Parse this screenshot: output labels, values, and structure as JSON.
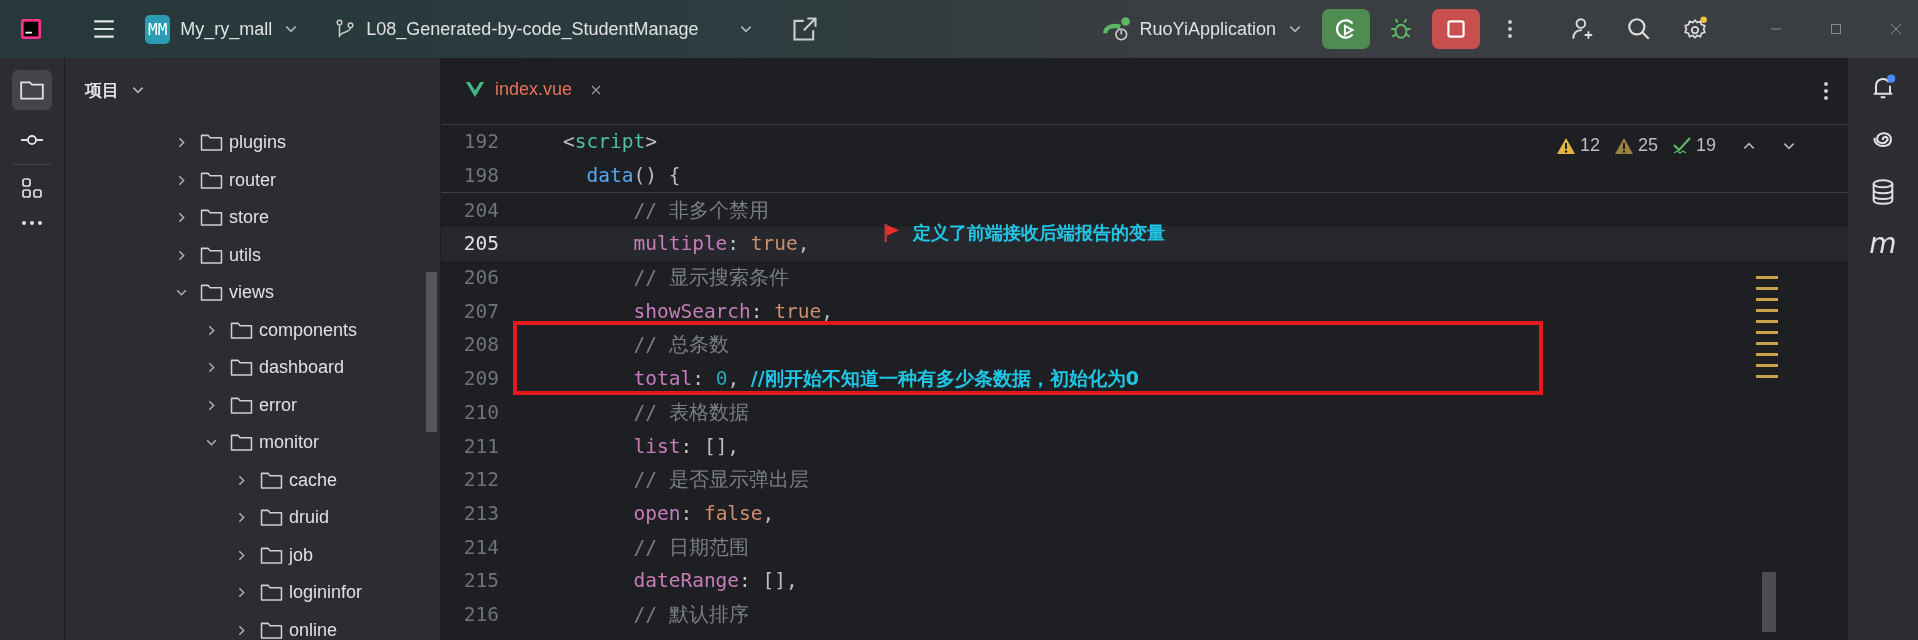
{
  "title_bar": {
    "project_badge": "MM",
    "project_name": "My_ry_mall",
    "branch": "L08_Generated-by-code_StudentManage",
    "run_config": "RuoYiApplication"
  },
  "project_panel": {
    "title": "项目",
    "tree": [
      {
        "name": "plugins",
        "expanded": false
      },
      {
        "name": "router",
        "expanded": false
      },
      {
        "name": "store",
        "expanded": false
      },
      {
        "name": "utils",
        "expanded": false
      },
      {
        "name": "views",
        "expanded": true,
        "children": [
          {
            "name": "components",
            "expanded": false
          },
          {
            "name": "dashboard",
            "expanded": false
          },
          {
            "name": "error",
            "expanded": false
          },
          {
            "name": "monitor",
            "expanded": true,
            "children": [
              {
                "name": "cache",
                "expanded": false
              },
              {
                "name": "druid",
                "expanded": false
              },
              {
                "name": "job",
                "expanded": false
              },
              {
                "name": "logininfor",
                "expanded": false
              },
              {
                "name": "online",
                "expanded": false
              }
            ]
          }
        ]
      }
    ]
  },
  "tabs": [
    {
      "label": "index.vue",
      "selected": true
    }
  ],
  "inspections": [
    {
      "kind": "warning",
      "count": "12"
    },
    {
      "kind": "weak-warning",
      "count": "25"
    },
    {
      "kind": "typo",
      "count": "19"
    }
  ],
  "sticky_lines": [
    {
      "number": "192",
      "kind": "tag",
      "current": false,
      "tokens": [
        {
          "kind": "punct",
          "text": "<"
        },
        {
          "kind": "tag",
          "text": "script"
        },
        {
          "kind": "punct",
          "text": ">"
        }
      ]
    },
    {
      "number": "198",
      "kind": "method",
      "current": false,
      "tokens": [
        {
          "kind": "fn",
          "text": "data"
        },
        {
          "kind": "plain",
          "text": "() {"
        }
      ]
    }
  ],
  "lines": [
    {
      "number": "204",
      "kind": "member",
      "current": false,
      "tokens": [
        {
          "kind": "comment",
          "text": "// 非多个禁用"
        }
      ]
    },
    {
      "number": "205",
      "kind": "member",
      "current": true,
      "tokens": [
        {
          "kind": "prop",
          "text": "multiple"
        },
        {
          "kind": "plain",
          "text": ": "
        },
        {
          "kind": "keyword",
          "text": "true"
        },
        {
          "kind": "plain",
          "text": ","
        }
      ]
    },
    {
      "number": "206",
      "kind": "member",
      "current": false,
      "tokens": [
        {
          "kind": "comment",
          "text": "// 显示搜索条件"
        }
      ]
    },
    {
      "number": "207",
      "kind": "member",
      "current": false,
      "tokens": [
        {
          "kind": "prop",
          "text": "showSearch"
        },
        {
          "kind": "plain",
          "text": ": "
        },
        {
          "kind": "keyword",
          "text": "true"
        },
        {
          "kind": "plain",
          "text": ","
        }
      ]
    },
    {
      "number": "208",
      "kind": "member",
      "current": false,
      "tokens": [
        {
          "kind": "comment",
          "text": "// 总条数"
        }
      ]
    },
    {
      "number": "209",
      "kind": "member",
      "current": false,
      "tokens": [
        {
          "kind": "prop",
          "text": "total"
        },
        {
          "kind": "plain",
          "text": ": "
        },
        {
          "kind": "number",
          "text": "0"
        },
        {
          "kind": "plain",
          "text": ", "
        },
        {
          "kind": "note",
          "text": "//刚开始不知道一种有多少条数据，初始化为0"
        }
      ]
    },
    {
      "number": "210",
      "kind": "member",
      "current": false,
      "tokens": [
        {
          "kind": "comment",
          "text": "// 表格数据"
        }
      ]
    },
    {
      "number": "211",
      "kind": "member",
      "current": false,
      "tokens": [
        {
          "kind": "prop",
          "text": "list"
        },
        {
          "kind": "plain",
          "text": ": [],"
        }
      ]
    },
    {
      "number": "212",
      "kind": "member",
      "current": false,
      "tokens": [
        {
          "kind": "comment",
          "text": "// 是否显示弹出层"
        }
      ]
    },
    {
      "number": "213",
      "kind": "member",
      "current": false,
      "tokens": [
        {
          "kind": "prop",
          "text": "open"
        },
        {
          "kind": "plain",
          "text": ": "
        },
        {
          "kind": "keyword",
          "text": "false"
        },
        {
          "kind": "plain",
          "text": ","
        }
      ]
    },
    {
      "number": "214",
      "kind": "member",
      "current": false,
      "tokens": [
        {
          "kind": "comment",
          "text": "// 日期范围"
        }
      ]
    },
    {
      "number": "215",
      "kind": "member",
      "current": false,
      "tokens": [
        {
          "kind": "prop",
          "text": "dateRange"
        },
        {
          "kind": "plain",
          "text": ": [],"
        }
      ]
    },
    {
      "number": "216",
      "kind": "member",
      "current": false,
      "tokens": [
        {
          "kind": "comment",
          "text": "// 默认排序"
        }
      ]
    }
  ],
  "annotation": {
    "text": "定义了前端接收后端报告的变量"
  },
  "right_strip": {
    "letter": "m"
  }
}
